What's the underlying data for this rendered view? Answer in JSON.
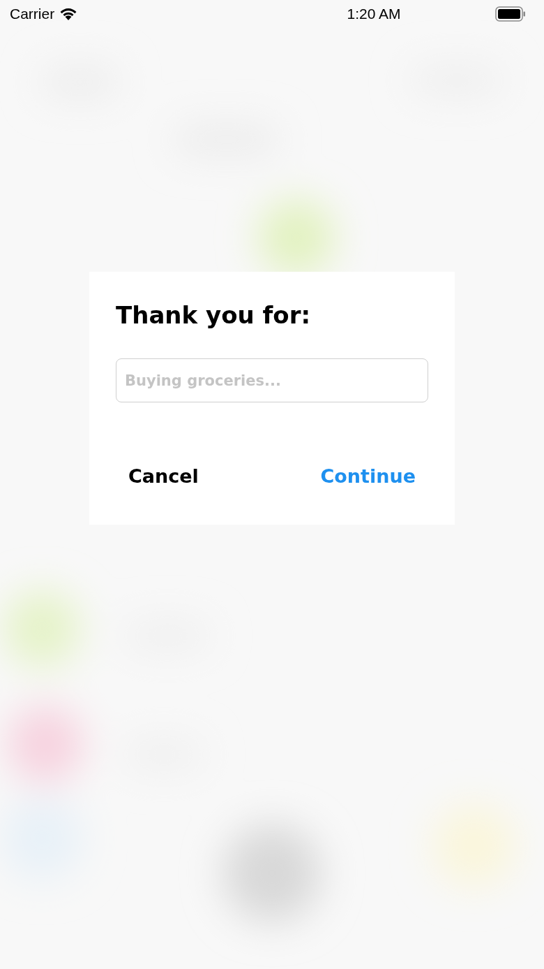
{
  "status_bar": {
    "carrier": "Carrier",
    "time": "1:20 AM"
  },
  "dialog": {
    "title": "Thank you for:",
    "field": {
      "placeholder": "Buying groceries..."
    },
    "buttons": [
      {
        "label": "Cancel",
        "kind": "cancel"
      },
      {
        "label": "Continue",
        "kind": "primary"
      }
    ]
  }
}
